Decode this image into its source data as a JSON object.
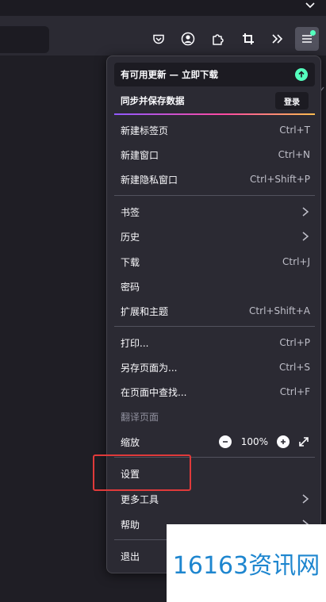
{
  "menu": {
    "update_label": "有可用更新 — 立即下载",
    "sync_label": "同步并保存数据",
    "signin_label": "登录",
    "groups": [
      [
        {
          "label": "新建标签页",
          "shortcut": "Ctrl+T"
        },
        {
          "label": "新建窗口",
          "shortcut": "Ctrl+N"
        },
        {
          "label": "新建隐私窗口",
          "shortcut": "Ctrl+Shift+P"
        }
      ],
      [
        {
          "label": "书签",
          "submenu": true
        },
        {
          "label": "历史",
          "submenu": true
        },
        {
          "label": "下载",
          "shortcut": "Ctrl+J"
        },
        {
          "label": "密码"
        },
        {
          "label": "扩展和主题",
          "shortcut": "Ctrl+Shift+A"
        }
      ],
      [
        {
          "label": "打印...",
          "shortcut": "Ctrl+P"
        },
        {
          "label": "另存页面为...",
          "shortcut": "Ctrl+S"
        },
        {
          "label": "在页面中查找...",
          "shortcut": "Ctrl+F"
        },
        {
          "label": "翻译页面",
          "disabled": true
        },
        {
          "label": "缩放"
        }
      ],
      [
        {
          "label": "设置"
        },
        {
          "label": "更多工具",
          "submenu": true
        },
        {
          "label": "帮助",
          "submenu": true
        }
      ],
      [
        {
          "label": "退出"
        }
      ]
    ],
    "zoom_value": "100%"
  },
  "toolbar_icons": [
    "pocket-icon",
    "account-icon",
    "extensions-icon",
    "screenshot-icon",
    "overflow-chevrons-icon",
    "app-menu-icon"
  ],
  "watermark": "16163资讯网",
  "colors": {
    "accent_green": "#54ffbd",
    "panel_bg": "#2b2a33",
    "highlight_red": "#e03a3a",
    "watermark_blue": "#1e86cf"
  }
}
